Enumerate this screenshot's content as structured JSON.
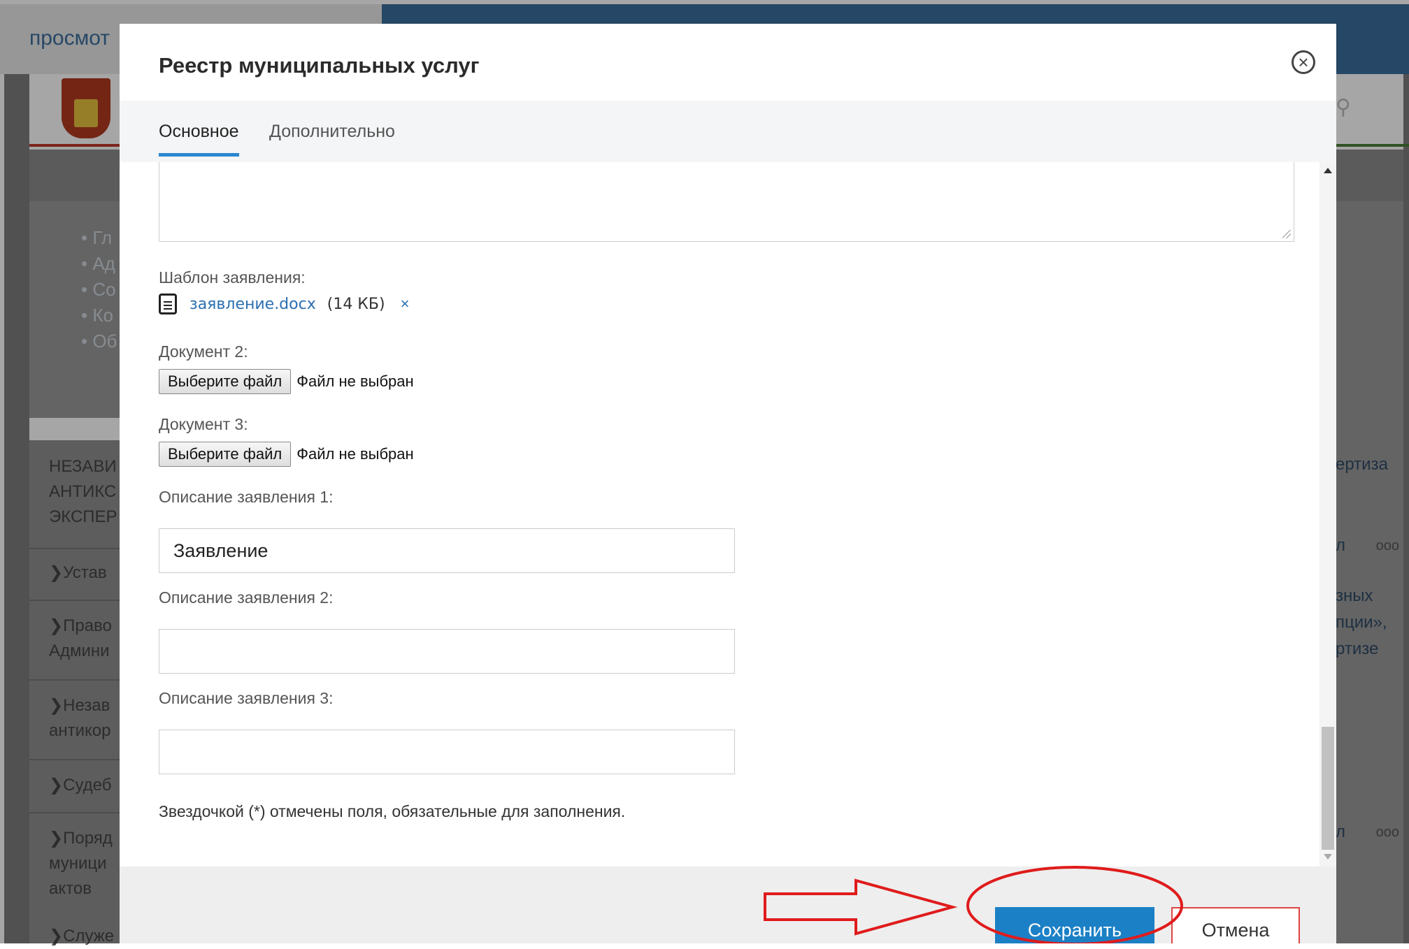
{
  "background": {
    "header_link": "просмот",
    "left_menu_bullets": [
      "Гл",
      "Ад",
      "Со",
      "Ко",
      "Об"
    ],
    "left_heading_lines": [
      "НЕЗАВИ",
      "АНТИКС",
      "ЭКСПЕР"
    ],
    "left_items": [
      "Устав",
      "Право",
      "Админи",
      "Незав",
      "антикор",
      "Судеб",
      "Поряд",
      "муници",
      "актов",
      "Служе"
    ],
    "right_text": [
      "ертиза",
      "л",
      "зных",
      "пции»,",
      "ртизе",
      "л"
    ],
    "right_dots": [
      "ooo",
      "ooo"
    ]
  },
  "modal": {
    "title": "Реестр муниципальных услуг",
    "close_icon": "close-circle-icon",
    "tabs": [
      {
        "label": "Основное",
        "active": true
      },
      {
        "label": "Дополнительно",
        "active": false
      }
    ],
    "template_label": "Шаблон заявления:",
    "template_file": {
      "icon": "document-icon",
      "name": "заявление.docx",
      "size": "(14 КБ)",
      "remove": "×"
    },
    "doc2_label": "Документ 2:",
    "doc3_label": "Документ 3:",
    "choose_file": "Выберите файл",
    "no_file": "Файл не выбран",
    "desc1_label": "Описание заявления 1:",
    "desc1_value": "Заявление",
    "desc2_label": "Описание заявления 2:",
    "desc2_value": "",
    "desc3_label": "Описание заявления 3:",
    "desc3_value": "",
    "required_note": "Звездочкой (*) отмечены поля, обязательные для заполнения.",
    "save_label": "Сохранить",
    "cancel_label": "Отмена"
  },
  "colors": {
    "accent": "#1b80c6",
    "tab_underline": "#2a87d0",
    "annotation": "#e01b1b",
    "header_blue": "#3b6e9c"
  }
}
